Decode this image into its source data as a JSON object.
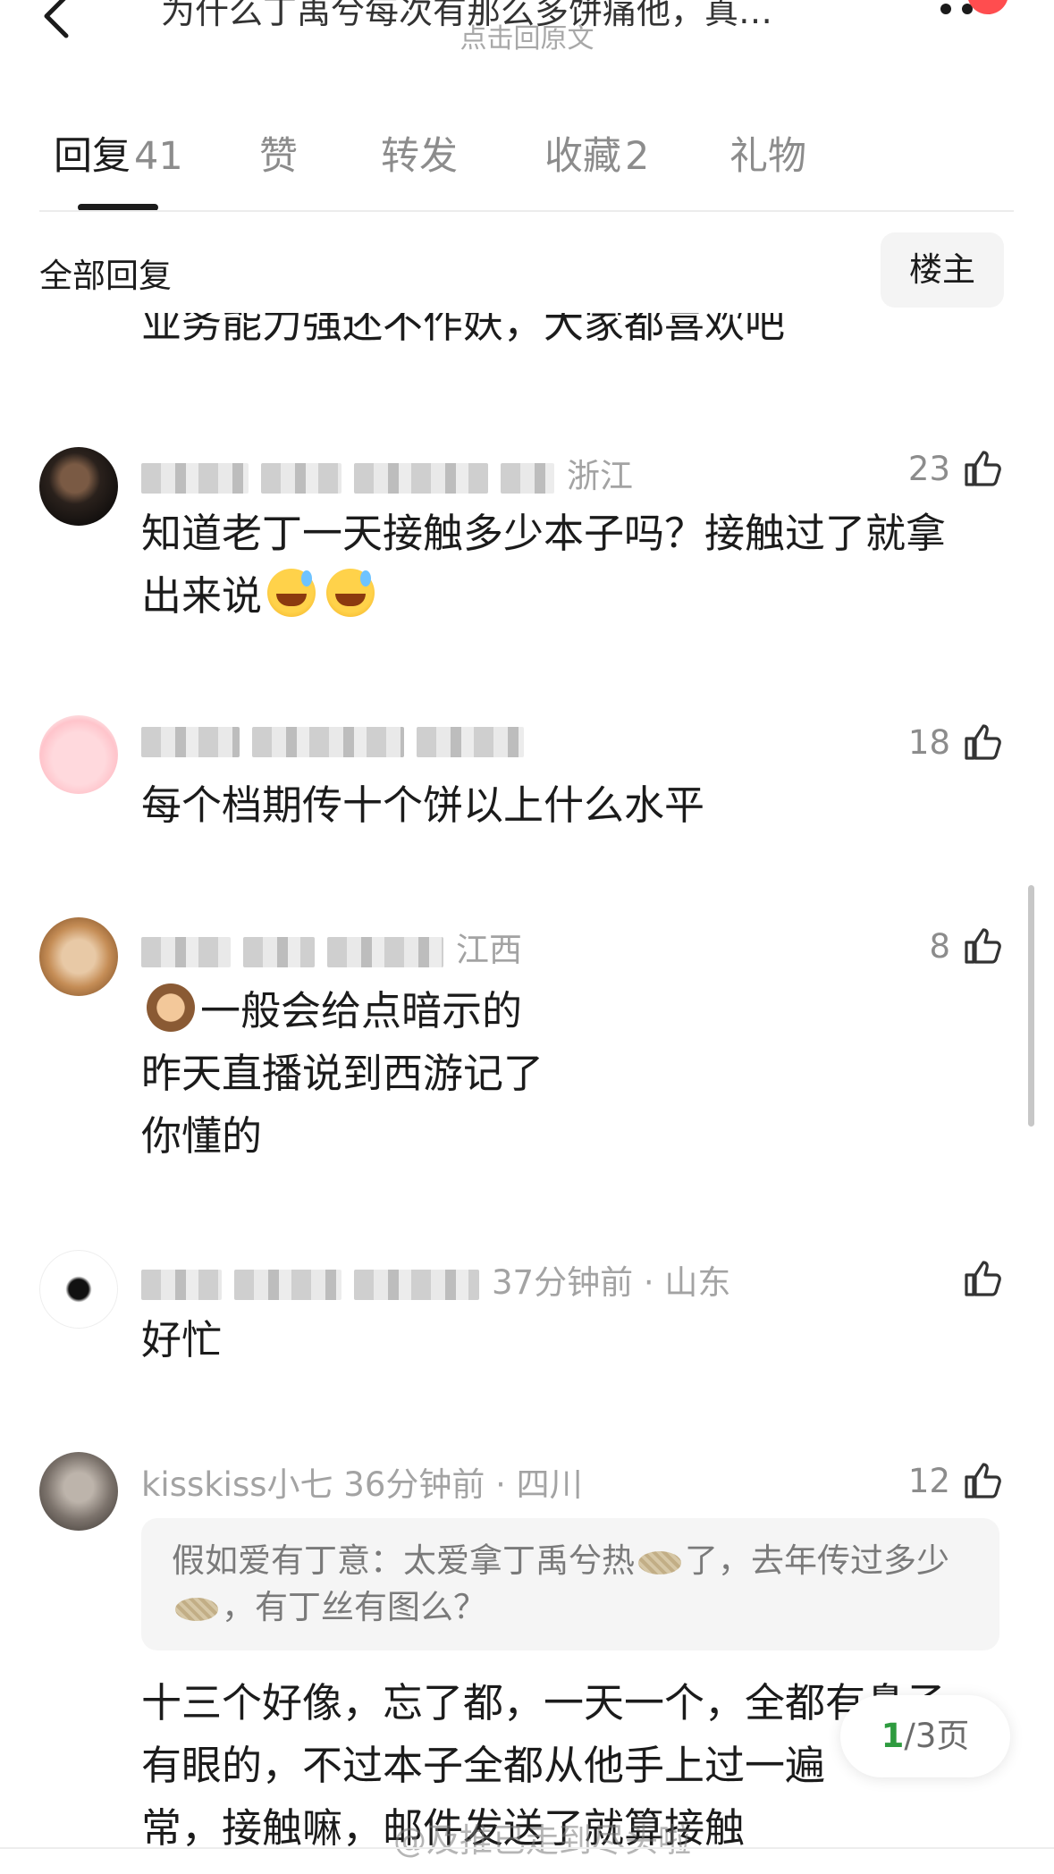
{
  "header": {
    "title": "为什么丁禹兮每次有那么多饼痛他，真…",
    "subtitle": "点击回原文"
  },
  "tabs": [
    {
      "label": "回复",
      "count": "41"
    },
    {
      "label": "赞",
      "count": ""
    },
    {
      "label": "转发",
      "count": ""
    },
    {
      "label": "收藏",
      "count": "2"
    },
    {
      "label": "礼物",
      "count": ""
    }
  ],
  "filter": {
    "label": "全部回复",
    "owner_button": "楼主"
  },
  "prev_comment_tail": "业务能力强还不作妖，大家都喜欢吧",
  "comments": [
    {
      "meta": "浙江",
      "likes": "23",
      "lines": [
        "知道老丁一天接触多少本子吗？接触过了就拿",
        "出来说"
      ]
    },
    {
      "meta": "",
      "likes": "18",
      "lines": [
        "每个档期传十个饼以上什么水平"
      ]
    },
    {
      "meta": "江西",
      "likes": "8",
      "lines": [
        "一般会给点暗示的",
        "昨天直播说到西游记了",
        "你懂的"
      ]
    },
    {
      "meta": "37分钟前 · 山东",
      "likes": "",
      "lines": [
        "好忙"
      ]
    },
    {
      "user": "kisskiss小七",
      "meta": "36分钟前 · 四川",
      "likes": "12",
      "quote": {
        "user": "假如爱有丁意",
        "text_a": "太爱拿丁禹兮热",
        "text_b": "了，去年传过多少",
        "text_c": "，有丁丝有图么？"
      },
      "lines": [
        "十三个好像，忘了都，一天一个，全都有鼻子",
        "有眼的，不过本子全都从他手上过一遍",
        "常，接触嘛，邮件发送了就算接触"
      ]
    }
  ],
  "pager": {
    "current": "1",
    "rest": "/3页"
  },
  "watermark": "@及推已走到尽头啦"
}
